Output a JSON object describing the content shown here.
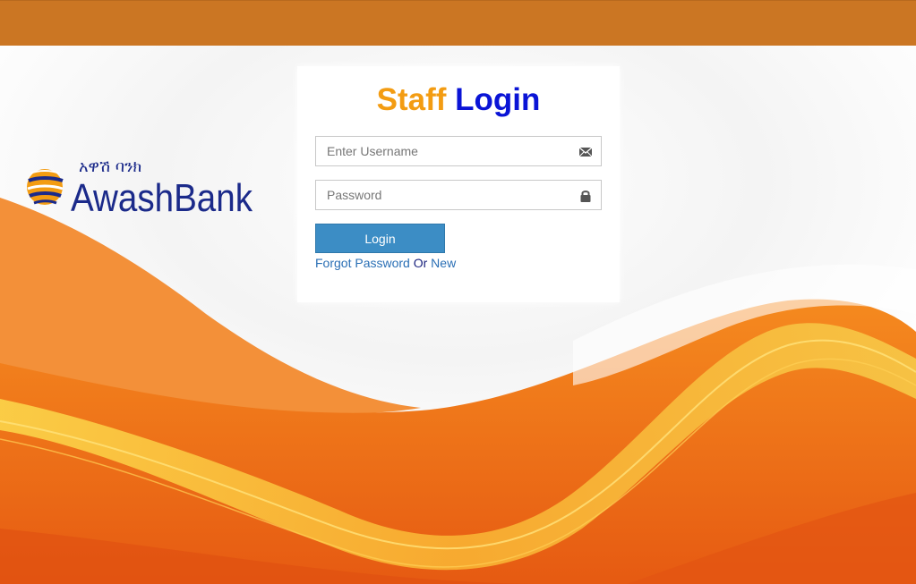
{
  "header": {
    "color": "#cb7623"
  },
  "brand": {
    "name": "AwashBank",
    "amharic_name": "አዋሽ ባንክ",
    "primary_color": "#1b2a8a",
    "accent_color": "#f39c12"
  },
  "login": {
    "title_part1": "Staff",
    "title_part2": "Login",
    "title_part1_color": "#f39c12",
    "title_part2_color": "#0a14d6",
    "username": {
      "placeholder": "Enter Username",
      "value": "",
      "icon": "envelope-icon"
    },
    "password": {
      "placeholder": "Password",
      "value": "",
      "icon": "lock-icon"
    },
    "submit_label": "Login",
    "submit_color": "#3c8dc5",
    "forgot_label": "Forgot Password",
    "or_label": "Or",
    "new_label": "New"
  }
}
